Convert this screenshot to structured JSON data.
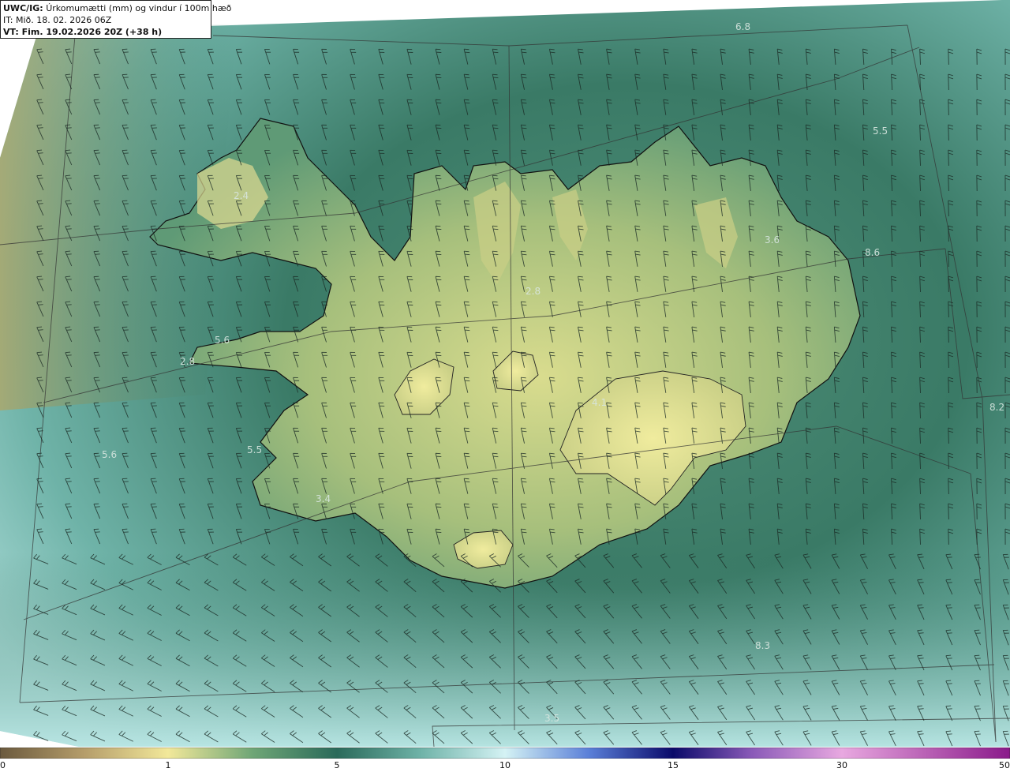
{
  "info": {
    "model": "UWC/IG:",
    "title": "Úrkomumætti (mm) og vindur í 100m hæð",
    "it": "IT: Mið. 18. 02. 2026 06Z",
    "vt": "VT: Fim. 19.02.2026 20Z (+38 h)"
  },
  "value_labels": [
    {
      "text": "6.8"
    },
    {
      "text": "2.4"
    },
    {
      "text": "3.6"
    },
    {
      "text": "2.8"
    },
    {
      "text": "5.6"
    },
    {
      "text": "2.8"
    },
    {
      "text": "5.5"
    },
    {
      "text": "5.6"
    },
    {
      "text": "3.4"
    },
    {
      "text": "8.2"
    },
    {
      "text": "8.3"
    },
    {
      "text": "8.6"
    },
    {
      "text": "4.1"
    },
    {
      "text": "3.5"
    },
    {
      "text": "5.5"
    }
  ],
  "colorbar": {
    "ticks": [
      "0",
      "1",
      "5",
      "10",
      "15",
      "30",
      "50"
    ],
    "stops": [
      {
        "value": "0",
        "color": "#6b5a3e"
      },
      {
        "value": "0.5",
        "color": "#b59d6a"
      },
      {
        "value": "1",
        "color": "#f2e89a"
      },
      {
        "value": "3",
        "color": "#6fa676"
      },
      {
        "value": "5",
        "color": "#2a6a5a"
      },
      {
        "value": "7.5",
        "color": "#6fb3a8"
      },
      {
        "value": "10",
        "color": "#d4f2f4"
      },
      {
        "value": "12.5",
        "color": "#5a7fd8"
      },
      {
        "value": "15",
        "color": "#0a0a6a"
      },
      {
        "value": "22",
        "color": "#8a5ab8"
      },
      {
        "value": "30",
        "color": "#e8a8e0"
      },
      {
        "value": "50",
        "color": "#8a1a8a"
      }
    ]
  },
  "colors": {
    "sea_dark": "#2f6d5c",
    "sea_light": "#a9dad6",
    "land_yellow": "#e3e094",
    "land_green": "#8db07a",
    "coast": "#111111"
  }
}
